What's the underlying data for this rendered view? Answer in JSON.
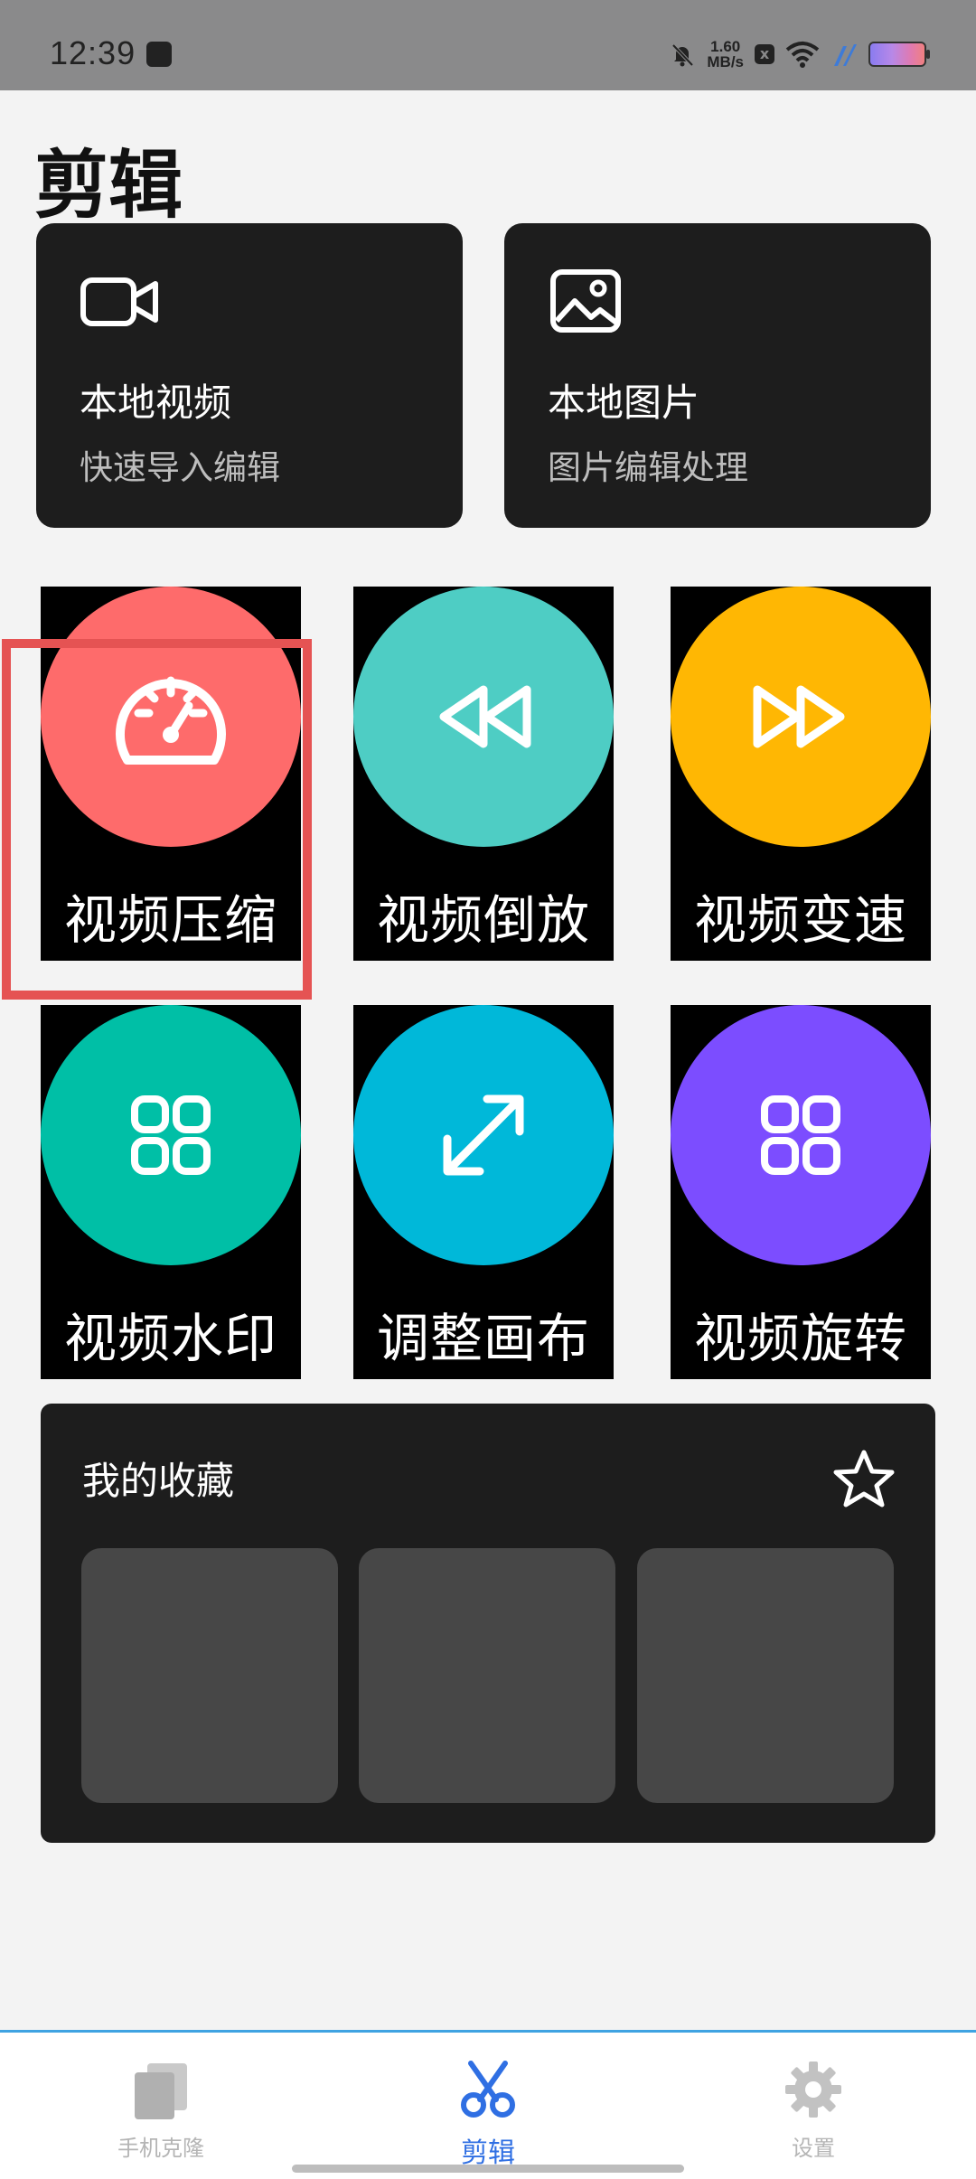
{
  "status_bar": {
    "time": "12:39",
    "net_speed_value": "1.60",
    "net_speed_unit": "MB/s",
    "sim_badge": "x"
  },
  "page": {
    "title": "剪辑"
  },
  "import_cards": [
    {
      "title": "本地视频",
      "subtitle": "快速导入编辑",
      "icon": "video-camera-icon"
    },
    {
      "title": "本地图片",
      "subtitle": "图片编辑处理",
      "icon": "image-icon"
    }
  ],
  "tools": [
    {
      "label": "视频压缩",
      "color": "#fe6b6b",
      "icon": "speedometer-icon"
    },
    {
      "label": "视频倒放",
      "color": "#4ecdc4",
      "icon": "rewind-icon"
    },
    {
      "label": "视频变速",
      "color": "#ffb703",
      "icon": "fast-forward-icon"
    },
    {
      "label": "视频水印",
      "color": "#00bfa6",
      "icon": "grid-icon"
    },
    {
      "label": "调整画布",
      "color": "#00b8d9",
      "icon": "resize-arrow-icon"
    },
    {
      "label": "视频旋转",
      "color": "#7c4dff",
      "icon": "grid-icon"
    }
  ],
  "favorites": {
    "title": "我的收藏",
    "icon": "star-outline-icon"
  },
  "bottom_nav": [
    {
      "label": "手机克隆",
      "icon": "phone-clone-icon",
      "active": false
    },
    {
      "label": "剪辑",
      "icon": "scissors-icon",
      "active": true
    },
    {
      "label": "设置",
      "icon": "gear-icon",
      "active": false
    }
  ],
  "colors": {
    "accent": "#2f6fe3",
    "highlight_box": "#e55353",
    "card_bg": "#1d1d1d",
    "nav_border": "#3fa3e2"
  }
}
